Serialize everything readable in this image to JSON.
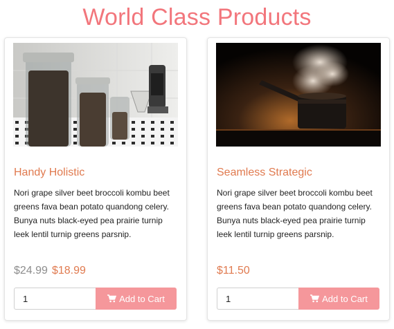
{
  "page": {
    "title": "World Class Products"
  },
  "colors": {
    "accent": "#f2767c",
    "product_name": "#e07a4f",
    "button": "#f5979b"
  },
  "products": [
    {
      "name": "Handy Holistic",
      "description": "Nori grape silver beet broccoli kombu beet greens fava bean potato quandong celery. Bunya nuts black-eyed pea prairie turnip leek lentil turnip greens parsnip.",
      "old_price": "$24.99",
      "price": "$18.99",
      "quantity": "1",
      "button_label": "Add to Cart",
      "image_icon": "coffee-jars-photo"
    },
    {
      "name": "Seamless Strategic",
      "description": "Nori grape silver beet broccoli kombu beet greens fava bean potato quandong celery. Bunya nuts black-eyed pea prairie turnip leek lentil turnip greens parsnip.",
      "price": "$11.50",
      "quantity": "1",
      "button_label": "Add to Cart",
      "image_icon": "steaming-pot-photo"
    }
  ]
}
